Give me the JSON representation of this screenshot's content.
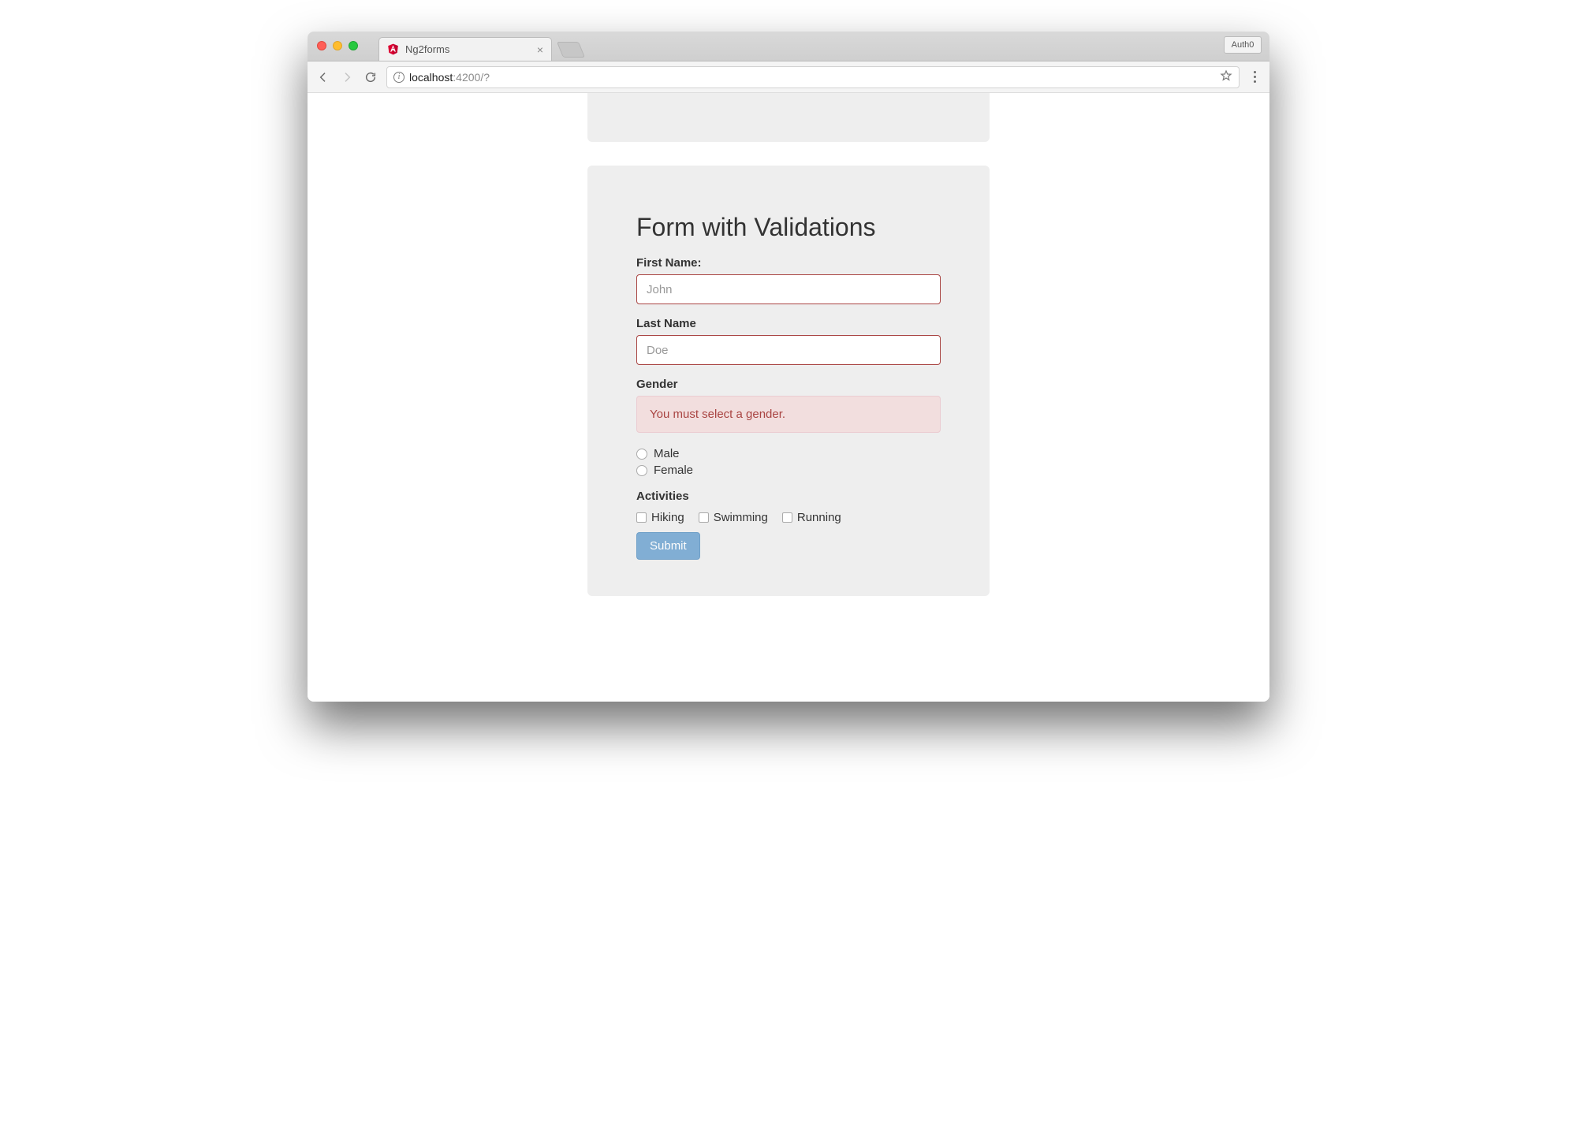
{
  "browser": {
    "tab_title": "Ng2forms",
    "auth_badge": "Auth0",
    "url": {
      "host": "localhost",
      "port": ":4200",
      "path": "/?"
    }
  },
  "form": {
    "heading": "Form with Validations",
    "first_name": {
      "label": "First Name:",
      "placeholder": "John",
      "value": ""
    },
    "last_name": {
      "label": "Last Name",
      "placeholder": "Doe",
      "value": ""
    },
    "gender": {
      "label": "Gender",
      "error": "You must select a gender.",
      "options": [
        "Male",
        "Female"
      ]
    },
    "activities": {
      "label": "Activities",
      "options": [
        "Hiking",
        "Swimming",
        "Running"
      ]
    },
    "submit_label": "Submit"
  }
}
